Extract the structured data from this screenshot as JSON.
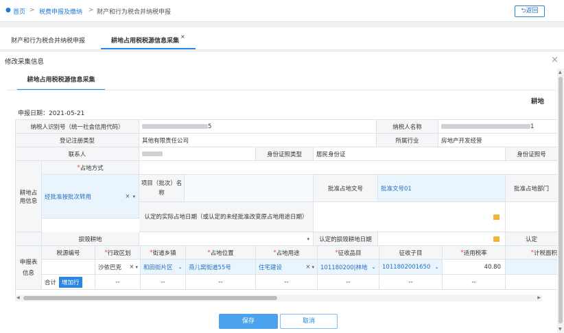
{
  "breadcrumb": {
    "home": "首页",
    "sep": ">",
    "level2": "税费申报及缴纳",
    "level3": "财产和行为税合并纳税申报"
  },
  "back_label": "返回",
  "tabs": [
    {
      "label": "财产和行为税合并纳税申报"
    },
    {
      "label": "耕地占用税税源信息采集"
    }
  ],
  "tab_close": "×",
  "modal": {
    "title": "修改采集信息",
    "close": "×"
  },
  "inner_tab": "耕地占用税税源信息采集",
  "header_right": "耕地",
  "filing_date": "申报日期：2021-05-21",
  "form": {
    "taxpayer_id_label": "纳税人识别号（统一社会信用代码）",
    "taxpayer_id_tail": "5",
    "taxpayer_name_label": "纳税人名称",
    "taxpayer_name_tail": "1",
    "reg_type_label": "登记注册类型",
    "reg_type_value": "其他有限责任公司",
    "industry_label": "所属行业",
    "industry_value": "房地产开发经营",
    "contact_label": "联系人",
    "id_type_label": "身份证照类型",
    "id_type_value": "居民身份证",
    "id_no_label": "身份证照号",
    "section_land": "耕地占用信息",
    "occupy_method_label": "占地方式",
    "occupy_method_value": "经批准按批次转用",
    "project_label": "项目（批次）名称",
    "approval_no_label": "批准占地文号",
    "approval_no_value": "批准文号01",
    "approval_dept_label": "批准占地部门",
    "actual_date_label": "认定的实际占地日期（或认定的未经批准改变原占地用途日期）",
    "damage_label": "损毁耕地",
    "damage_date_label": "认定的损毁耕地日期",
    "damage_right_label": "认定"
  },
  "table": {
    "section": "申报表信息",
    "headers": [
      "税源编号",
      "行政区划",
      "街道乡镇",
      "占地位置",
      "占地用途",
      "征收品目",
      "征收子目",
      "适用税率",
      "计税面积"
    ],
    "required": [
      false,
      true,
      true,
      true,
      true,
      true,
      false,
      true,
      true
    ],
    "row": {
      "district": "沙依巴克",
      "street": "和田街片区",
      "location": "燕儿窝街道55号",
      "use": "住宅建设",
      "item": "101180200|林地",
      "subitem": "1011802001650",
      "rate": "40.80"
    },
    "total_label": "合计",
    "add_row": "增加行",
    "dash": "--"
  },
  "buttons": {
    "save": "保存",
    "cancel": "取消"
  }
}
